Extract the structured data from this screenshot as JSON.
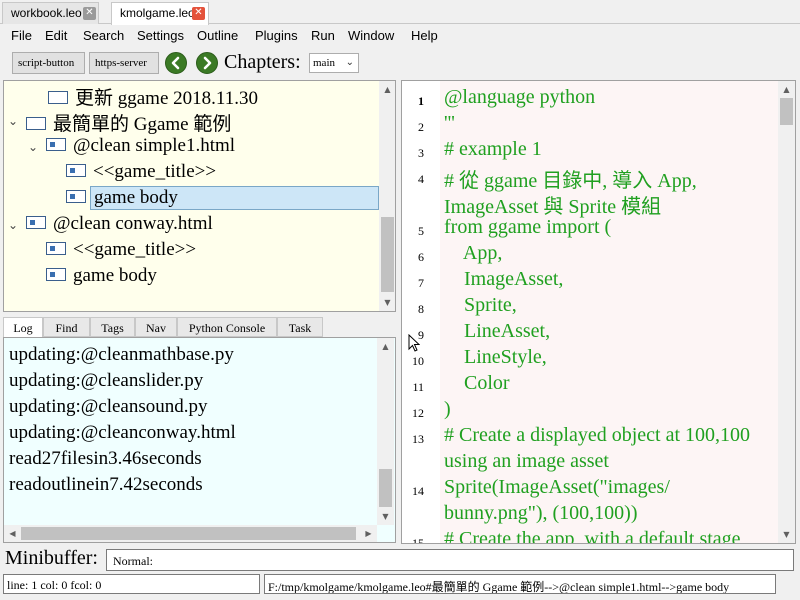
{
  "tabs": [
    {
      "label": "workbook.leo"
    },
    {
      "label": "kmolgame.leo"
    }
  ],
  "menu": [
    "File",
    "Edit",
    "Search",
    "Settings",
    "Outline",
    "Plugins",
    "Run",
    "Window",
    "Help"
  ],
  "toolbar": {
    "script_button": "script-button",
    "https_server": "https-server",
    "chapters_label": "Chapters:",
    "chapter_value": "main"
  },
  "outline": {
    "nodes": [
      {
        "label": "更新 ggame 2018.11.30"
      },
      {
        "label": "最簡單的 Ggame 範例"
      },
      {
        "label": "@clean simple1.html"
      },
      {
        "label": "<<game_title>>"
      },
      {
        "label": "game body"
      },
      {
        "label": "@clean conway.html"
      },
      {
        "label": "<<game_title>>"
      },
      {
        "label": "game body"
      }
    ]
  },
  "log_tabs": [
    "Log",
    "Find",
    "Tags",
    "Nav",
    "Python Console",
    "Task"
  ],
  "log_lines": [
    "updating:@cleanmathbase.py",
    "updating:@cleanslider.py",
    "updating:@cleansound.py",
    "updating:@cleanconway.html",
    "read27filesin3.46seconds",
    "readoutlinein7.42seconds"
  ],
  "body": {
    "line_numbers": [
      "1",
      "2",
      "3",
      "4",
      "5",
      "6",
      "7",
      "8",
      "9",
      "10",
      "11",
      "12",
      "13",
      "14",
      "15"
    ],
    "code_lines": [
      "@language python",
      "'''",
      "# example 1",
      "# 從 ggame 目錄中, 導入 App,",
      "ImageAsset 與 Sprite 模組",
      "from ggame import (",
      "    App,",
      "    ImageAsset,",
      "    Sprite,",
      "    LineAsset,",
      "    LineStyle,",
      "    Color",
      ")",
      "# Create a displayed object at 100,100",
      "using an image asset",
      "Sprite(ImageAsset(\"images/",
      "bunny.png\"), (100,100))",
      "# Create the app, with a default stage"
    ]
  },
  "minibuffer": {
    "label": "Minibuffer:",
    "value": "Normal:"
  },
  "status": {
    "position": "line: 1 col: 0 fcol: 0",
    "path": "F:/tmp/kmolgame/kmolgame.leo#最簡單的 Ggame 範例-->@clean simple1.html-->game body"
  }
}
